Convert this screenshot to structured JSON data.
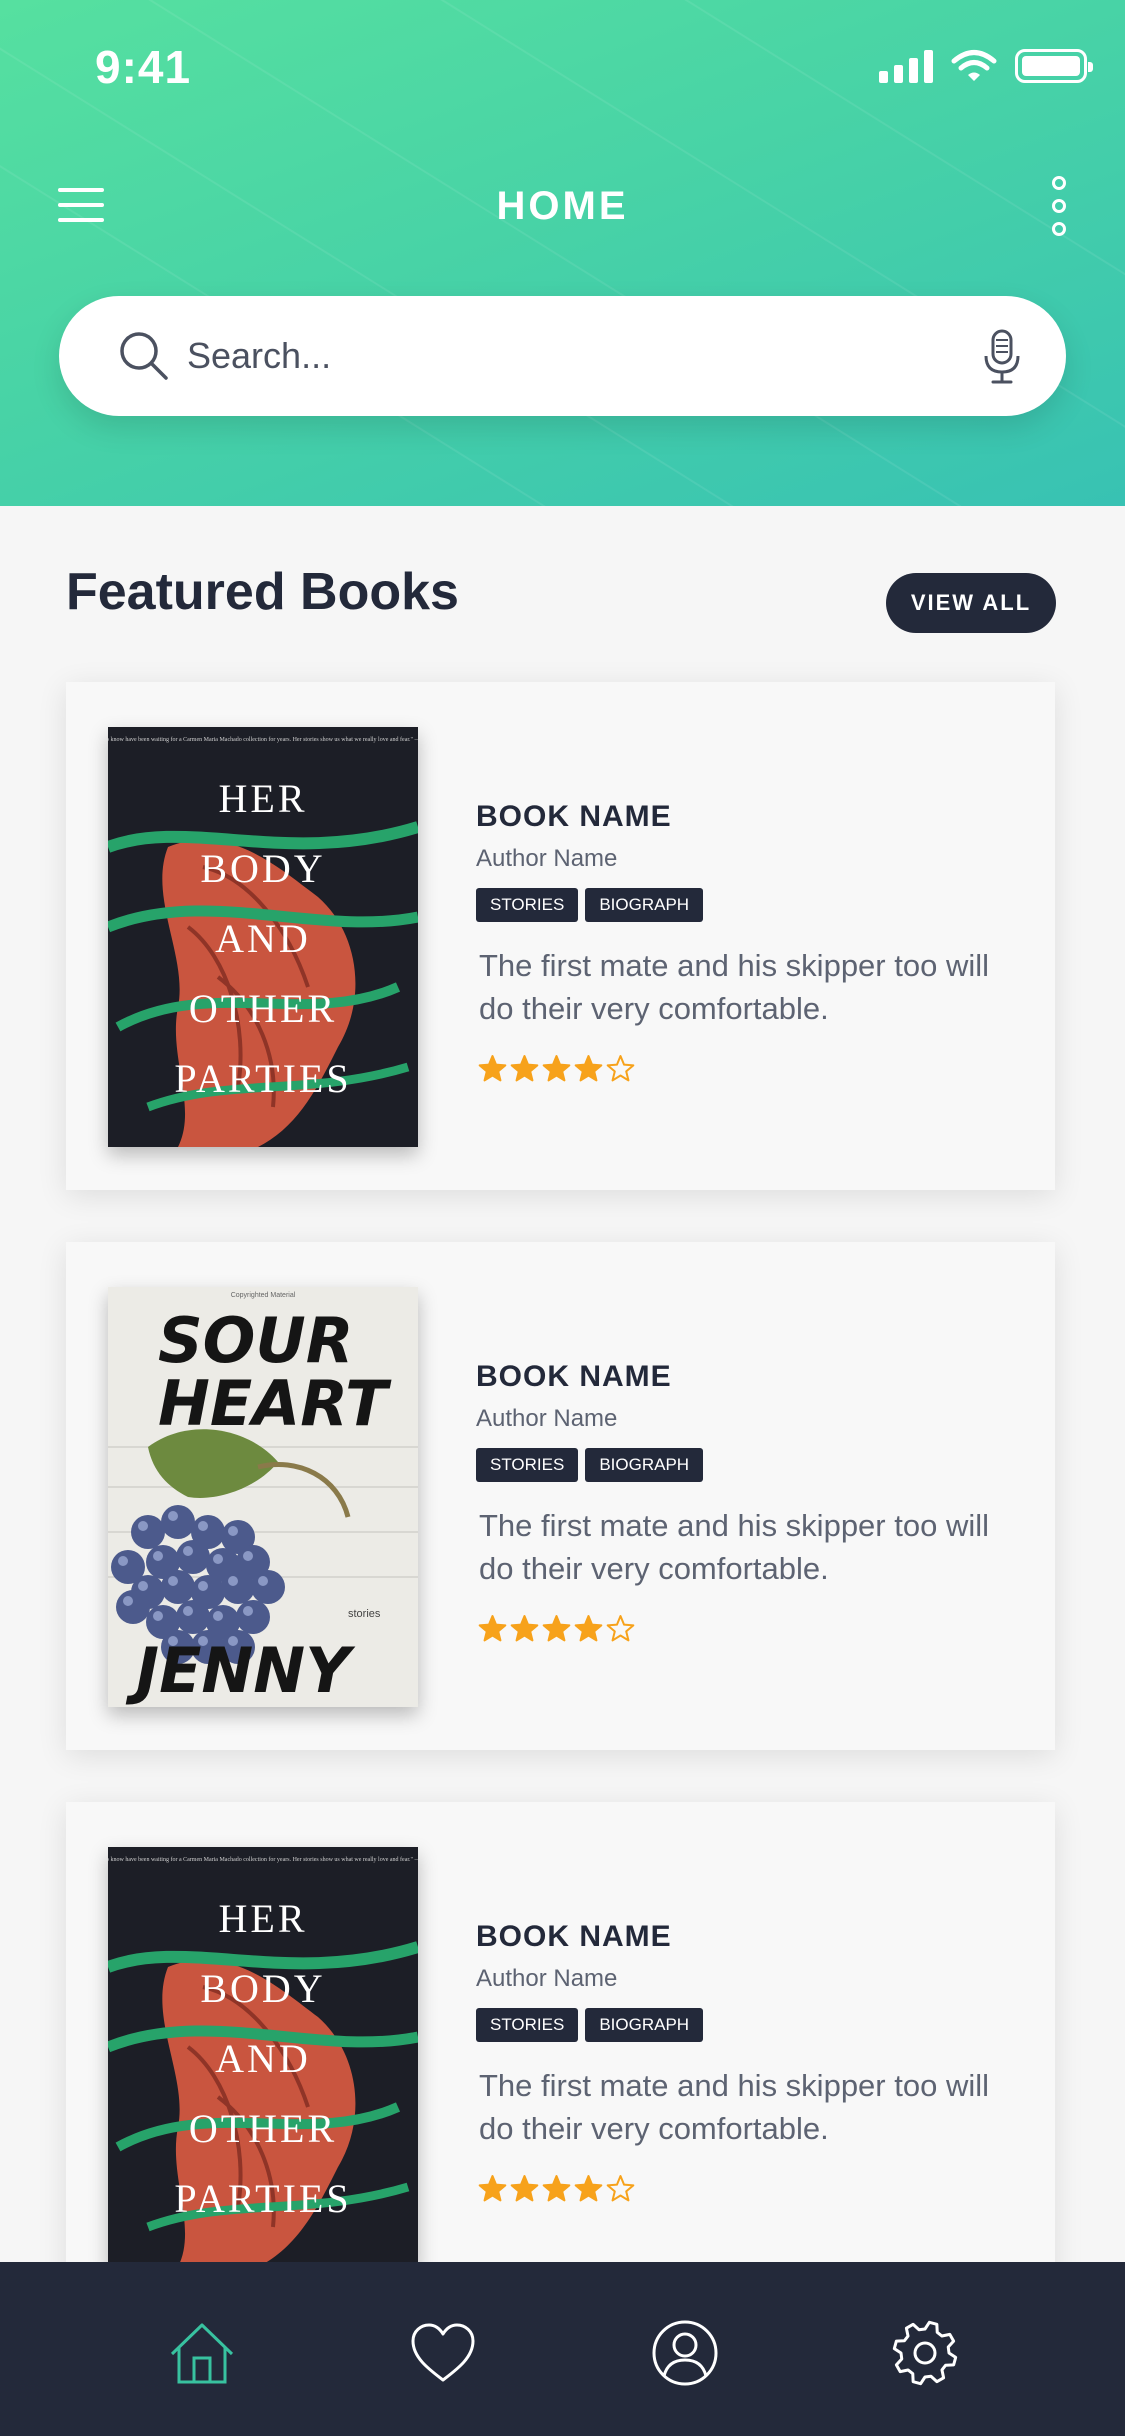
{
  "status_bar": {
    "time": "9:41"
  },
  "header": {
    "title": "HOME",
    "gradient_colors": [
      "#56e0a0",
      "#38c2b3"
    ]
  },
  "search": {
    "placeholder": "Search..."
  },
  "featured": {
    "title": "Featured Books",
    "view_all_label": "VIEW ALL"
  },
  "books": [
    {
      "name": "BOOK NAME",
      "author": "Author Name",
      "tags": [
        "STORIES",
        "BIOGRAPH"
      ],
      "description": "The first mate and his skipper too will do their very comfortable.",
      "rating": 4,
      "max_rating": 5,
      "cover": {
        "style": "dark",
        "quote": "\"Those of us who know have been waiting for a Carmen Maria Machado collection for years. Her stories show us what we really love and fear.\" —Alexander Chee",
        "title_lines": [
          "HER",
          "BODY",
          "AND",
          "OTHER",
          "PARTIES"
        ]
      }
    },
    {
      "name": "BOOK NAME",
      "author": "Author Name",
      "tags": [
        "STORIES",
        "BIOGRAPH"
      ],
      "description": "The first mate and his skipper too will do their very comfortable.",
      "rating": 4,
      "max_rating": 5,
      "cover": {
        "style": "light",
        "top_note": "Copyrighted Material",
        "title_lines": [
          "SOUR",
          "HEART"
        ],
        "author": "JENNY",
        "subtitle": "stories"
      }
    },
    {
      "name": "BOOK NAME",
      "author": "Author Name",
      "tags": [
        "STORIES",
        "BIOGRAPH"
      ],
      "description": "The first mate and his skipper too will do their very comfortable.",
      "rating": 4,
      "max_rating": 5,
      "cover": {
        "style": "dark",
        "quote": "\"Those of us who know have been waiting for a Carmen Maria Machado collection for years. Her stories show us what we really love and fear.\" —Alexander Chee",
        "title_lines": [
          "HER",
          "BODY",
          "AND",
          "OTHER",
          "PARTIES"
        ]
      }
    }
  ],
  "bottom_nav": {
    "items": [
      {
        "icon": "home-icon",
        "active": true
      },
      {
        "icon": "heart-icon",
        "active": false
      },
      {
        "icon": "profile-icon",
        "active": false
      },
      {
        "icon": "gear-icon",
        "active": false
      }
    ],
    "active_color": "#38c2a0",
    "inactive_color": "#ffffff"
  },
  "colors": {
    "star": "#f7a21b",
    "dark": "#23293a"
  }
}
